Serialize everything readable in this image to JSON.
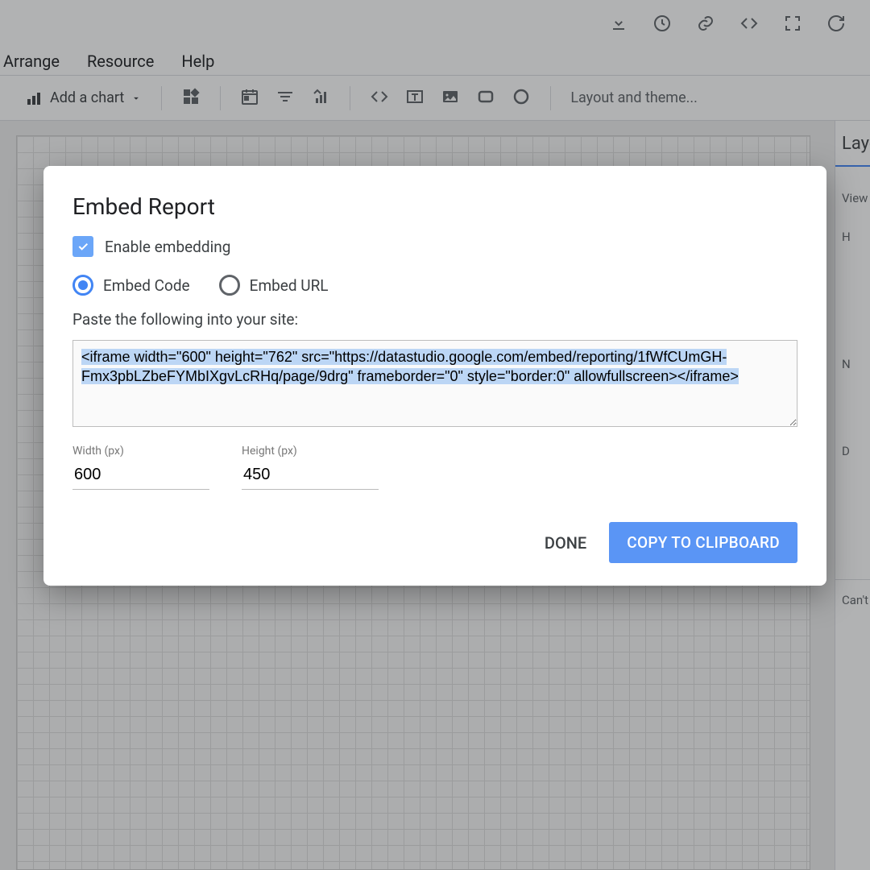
{
  "menubar": {
    "arrange": "Arrange",
    "resource": "Resource",
    "help": "Help"
  },
  "toolbar": {
    "add_chart": "Add a chart",
    "layout_theme": "Layout and theme..."
  },
  "sidepanel": {
    "title": "Layout",
    "view": "View",
    "h": "H",
    "n": "N",
    "d": "D",
    "cant": "Can't"
  },
  "dialog": {
    "title": "Embed Report",
    "enable_embedding": "Enable embedding",
    "radio_code": "Embed Code",
    "radio_url": "Embed URL",
    "paste_helper": "Paste the following into your site:",
    "code_text": "<iframe width=\"600\" height=\"762\" src=\"https://datastudio.google.com/embed/reporting/1fWfCUmGH-Fmx3pbLZbeFYMbIXgvLcRHq/page/9drg\" frameborder=\"0\" style=\"border:0\" allowfullscreen></iframe>",
    "width_label": "Width (px)",
    "width_value": "600",
    "height_label": "Height (px)",
    "height_value": "450",
    "done": "DONE",
    "copy": "COPY TO CLIPBOARD"
  }
}
